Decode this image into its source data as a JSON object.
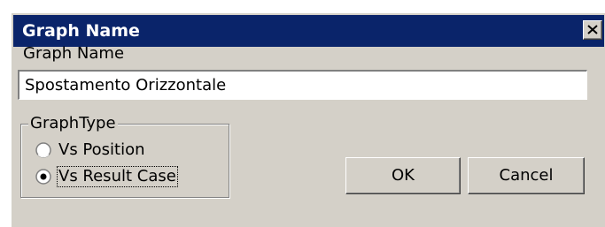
{
  "window": {
    "title": "Graph Name",
    "close_icon": "close-x-icon"
  },
  "form": {
    "name_label": "Graph Name",
    "name_value": "Spostamento Orizzontale"
  },
  "graph_type": {
    "legend": "GraphType",
    "options": [
      {
        "label": "Vs Position",
        "selected": false
      },
      {
        "label": "Vs Result Case",
        "selected": true
      }
    ]
  },
  "buttons": {
    "ok_label": "OK",
    "cancel_label": "Cancel"
  },
  "colors": {
    "titlebar": "#0a246a",
    "dialog_face": "#d4d0c8"
  }
}
